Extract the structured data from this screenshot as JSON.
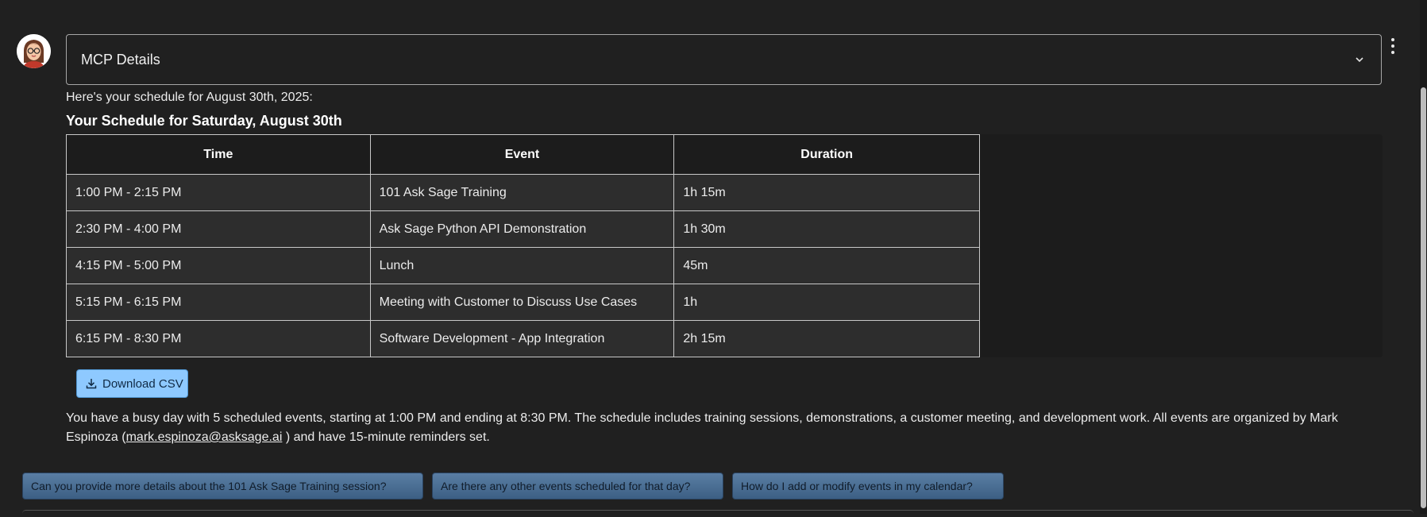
{
  "mcp": {
    "title": "MCP Details"
  },
  "message": {
    "intro": "Here's your schedule for August 30th, 2025:",
    "heading": "Your Schedule for Saturday, August 30th",
    "table": {
      "headers": [
        "Time",
        "Event",
        "Duration"
      ],
      "rows": [
        [
          "1:00 PM - 2:15 PM",
          "101 Ask Sage Training",
          "1h 15m"
        ],
        [
          "2:30 PM - 4:00 PM",
          "Ask Sage Python API Demonstration",
          "1h 30m"
        ],
        [
          "4:15 PM - 5:00 PM",
          "Lunch",
          "45m"
        ],
        [
          "5:15 PM - 6:15 PM",
          "Meeting with Customer to Discuss Use Cases",
          "1h"
        ],
        [
          "6:15 PM - 8:30 PM",
          "Software Development - App Integration",
          "2h 15m"
        ]
      ]
    },
    "download_label": "Download CSV",
    "summary_pre": "You have a busy day with 5 scheduled events, starting at 1:00 PM and ending at 8:30 PM. The schedule includes training sessions, demonstrations, a customer meeting, and development work. All events are organized by Mark Espinoza (",
    "summary_email": "mark.espinoza@asksage.ai",
    "summary_post": " ) and have 15-minute reminders set."
  },
  "suggestions": [
    "Can you provide more details about the 101 Ask Sage Training session?",
    "Are there any other events scheduled for that day?",
    "How do I add or modify events in my calendar?"
  ],
  "icons": {
    "avatar": "avatar-icon",
    "menu": "kebab-menu-icon",
    "chevron": "chevron-down-icon",
    "download": "download-icon"
  },
  "colors": {
    "background": "#202020",
    "download_button": "#8ec9ff",
    "suggestion_button": "#4a6e94"
  }
}
